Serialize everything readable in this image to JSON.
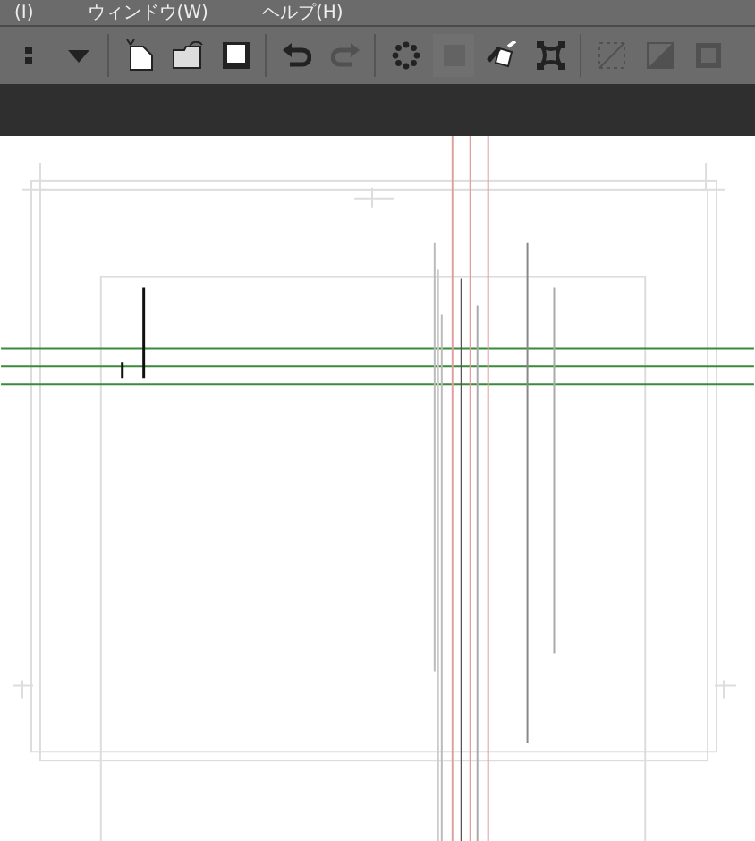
{
  "menu": [
    {
      "label": "(I)"
    },
    {
      "label": "ウィンドウ(W)"
    },
    {
      "label": "ヘルプ(H)"
    }
  ],
  "toolbar": [
    [
      {
        "kind": "grip",
        "disabled": false
      },
      {
        "kind": "dropdown",
        "disabled": false
      }
    ],
    [
      {
        "kind": "new",
        "disabled": false
      },
      {
        "kind": "open",
        "disabled": false
      },
      {
        "kind": "save",
        "disabled": false
      }
    ],
    [
      {
        "kind": "undo",
        "disabled": false
      },
      {
        "kind": "redo",
        "disabled": true
      }
    ],
    [
      {
        "kind": "dots",
        "disabled": false
      },
      {
        "kind": "select",
        "disabled": true
      },
      {
        "kind": "fill",
        "disabled": false
      },
      {
        "kind": "transform",
        "disabled": false
      }
    ],
    [
      {
        "kind": "clear",
        "disabled": true
      },
      {
        "kind": "gradient",
        "disabled": true
      },
      {
        "kind": "grid",
        "disabled": true
      }
    ]
  ]
}
